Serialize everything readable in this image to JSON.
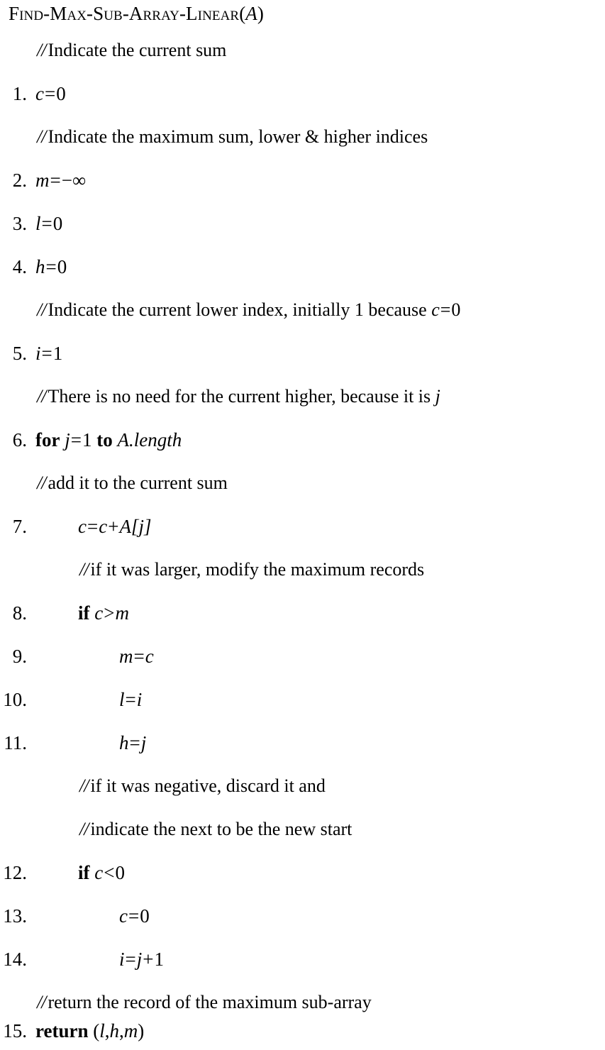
{
  "document": {
    "kind": "algorithm-pseudocode",
    "title": {
      "name_prefix": "F",
      "name_rest": "ind-",
      "full_name": "Find-Max-Sub-Array-Linear",
      "open_paren": "(",
      "argument": "A",
      "close_paren": ")",
      "full_text": "Find-Max-Sub-Array-Linear(A)"
    },
    "lines": [
      {
        "type": "comment",
        "indent": 0,
        "number": "",
        "marker": "//",
        "text": "Indicate the current sum",
        "full_text": "// Indicate the current sum"
      },
      {
        "type": "statement",
        "indent": 0,
        "number": "1.",
        "lhs": "c",
        "op": "=",
        "rhs": "0",
        "full_text": "c = 0"
      },
      {
        "type": "comment",
        "indent": 0,
        "number": "",
        "marker": "//",
        "text": "Indicate the maximum sum, lower & higher indices",
        "full_text": "// Indicate the maximum sum, lower & higher indices"
      },
      {
        "type": "statement",
        "indent": 0,
        "number": "2.",
        "lhs": "m",
        "op": "=",
        "rhs": "−∞",
        "full_text": "m = −∞"
      },
      {
        "type": "statement",
        "indent": 0,
        "number": "3.",
        "lhs": "l",
        "op": "=",
        "rhs": "0",
        "full_text": "l = 0"
      },
      {
        "type": "statement",
        "indent": 0,
        "number": "4.",
        "lhs": "h",
        "op": "=",
        "rhs": "0",
        "full_text": "h = 0"
      },
      {
        "type": "comment",
        "indent": 0,
        "number": "",
        "marker": "//",
        "text": "Indicate the current lower index, initially 1 because c = 0",
        "text_before_math": "Indicate the current lower index, initially 1 because",
        "math_var": "c",
        "math_op": "=",
        "math_val": "0",
        "full_text": "// Indicate the current lower index, initially 1 because c = 0"
      },
      {
        "type": "statement",
        "indent": 0,
        "number": "5.",
        "lhs": "i",
        "op": "=",
        "rhs": "1",
        "full_text": "i = 1"
      },
      {
        "type": "comment",
        "indent": 0,
        "number": "",
        "marker": "//",
        "text": "There is no need for the current higher, because it is j",
        "text_before_math": "There is no need for the current higher, because it is",
        "math_var": "j",
        "full_text": "// There is no need for the current higher, because it is j"
      },
      {
        "type": "loop",
        "indent": 0,
        "number": "6.",
        "keyword_for": "for",
        "var": "j",
        "op": "=",
        "start": "1",
        "keyword_to": "to",
        "limit": "A.length",
        "full_text": "for j = 1 to A.length"
      },
      {
        "type": "comment",
        "indent": 0,
        "number": "",
        "marker": "//",
        "text": "add it to the current sum",
        "full_text": "// add it to the current sum"
      },
      {
        "type": "statement",
        "indent": 1,
        "number": "7.",
        "lhs": "c",
        "op": "=",
        "rhs": "c + A[j]",
        "full_text": "c = c + A[j]"
      },
      {
        "type": "comment",
        "indent": 1,
        "number": "",
        "marker": "//",
        "text": "if it was larger, modify the maximum records",
        "full_text": "// if it was larger, modify the maximum records"
      },
      {
        "type": "conditional",
        "indent": 1,
        "number": "8.",
        "keyword_if": "if",
        "lhs": "c",
        "op": ">",
        "rhs": "m",
        "full_text": "if c > m"
      },
      {
        "type": "statement",
        "indent": 2,
        "number": "9.",
        "lhs": "m",
        "op": "=",
        "rhs": "c",
        "full_text": "m = c"
      },
      {
        "type": "statement",
        "indent": 2,
        "number": "10.",
        "lhs": "l",
        "op": "=",
        "rhs": "i",
        "full_text": "l = i"
      },
      {
        "type": "statement",
        "indent": 2,
        "number": "11.",
        "lhs": "h",
        "op": "=",
        "rhs": "j",
        "full_text": "h = j"
      },
      {
        "type": "comment",
        "indent": 1,
        "number": "",
        "marker": "//",
        "text": "if it was negative, discard it and",
        "full_text": "// if it was negative, discard it and"
      },
      {
        "type": "comment",
        "indent": 1,
        "number": "",
        "marker": "//",
        "text": "indicate the next to be the new start",
        "full_text": "// indicate the next to be the new start"
      },
      {
        "type": "conditional",
        "indent": 1,
        "number": "12.",
        "keyword_if": "if",
        "lhs": "c",
        "op": "<",
        "rhs": "0",
        "full_text": "if c < 0"
      },
      {
        "type": "statement",
        "indent": 2,
        "number": "13.",
        "lhs": "c",
        "op": "=",
        "rhs": "0",
        "full_text": "c = 0"
      },
      {
        "type": "statement",
        "indent": 2,
        "number": "14.",
        "lhs": "i",
        "op": "=",
        "rhs": "j + 1",
        "full_text": "i = j + 1"
      },
      {
        "type": "comment",
        "indent": 0,
        "number": "",
        "marker": "//",
        "text": "return the record of the maximum sub-array",
        "full_text": "// return the record of the maximum sub-array"
      },
      {
        "type": "return",
        "indent": 0,
        "number": "15.",
        "keyword_return": "return",
        "value": "(l, h, m)",
        "full_text": "return (l, h, m)"
      }
    ]
  },
  "rows": {
    "r0_comment": "Indicate the current sum",
    "r1_num": "1.",
    "r2_comment": "Indicate the maximum sum, lower & higher indices",
    "r3_num": "2.",
    "r4_num": "3.",
    "r5_num": "4.",
    "r6_comment_pre": "Indicate the current lower index, initially 1 because",
    "r7_num": "5.",
    "r8_comment_pre": "There is no need for the current higher, because it is",
    "r9_num": "6.",
    "r10_comment": "add it to the current sum",
    "r11_num": "7.",
    "r12_comment": "if it was larger, modify the maximum records",
    "r13_num": "8.",
    "r14_num": "9.",
    "r15_num": "10.",
    "r16_num": "11.",
    "r17_comment": "if it was negative, discard it and",
    "r18_comment": "indicate the next to be the new start",
    "r19_num": "12.",
    "r20_num": "13.",
    "r21_num": "14.",
    "r22_comment": "return the record of the maximum sub-array",
    "r23_num": "15."
  },
  "symbols": {
    "slashes": "//",
    "eq": "=",
    "gt": ">",
    "lt": "<",
    "plus": "+",
    "minus_inf": "−∞",
    "zero": "0",
    "one": "1",
    "var_c": "c",
    "var_m": "m",
    "var_l": "l",
    "var_h": "h",
    "var_i": "i",
    "var_j": "j",
    "var_A": "A",
    "a_index_j": "A[j]",
    "a_length": "A.length",
    "kw_for": "for",
    "kw_to": "to",
    "kw_if": "if",
    "kw_return": "return",
    "tuple_open": "(",
    "tuple_close": ")",
    "comma": ",",
    "title_arg": "A"
  },
  "colors": {
    "background": "#ffffff",
    "text": "#000000"
  }
}
